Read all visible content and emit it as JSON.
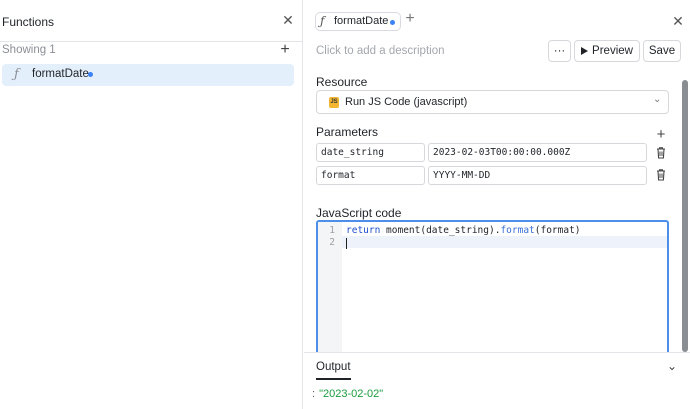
{
  "left_panel": {
    "title": "Functions",
    "close_glyph": "✕",
    "showing_label": "Showing 1",
    "add_glyph": "+",
    "functions": [
      {
        "icon": "function-icon",
        "glyph": "ƒ",
        "name": "formatDate",
        "unsaved": true
      }
    ]
  },
  "tab": {
    "glyph": "ƒ",
    "label": "formatDate",
    "add_glyph": "+",
    "close_glyph": "✕"
  },
  "toolbar": {
    "description_placeholder": "Click to add a description",
    "more_label": "···",
    "preview_label": "Preview",
    "save_label": "Save"
  },
  "resource": {
    "section_label": "Resource",
    "badge": "JS",
    "value": "Run JS Code (javascript)",
    "chevron": "⌄"
  },
  "parameters": {
    "section_label": "Parameters",
    "add_glyph": "+",
    "rows": [
      {
        "name": "date_string",
        "value": "2023-02-03T00:00:00.000Z"
      },
      {
        "name": "format",
        "value": "YYYY-MM-DD"
      }
    ]
  },
  "code": {
    "section_label": "JavaScript code",
    "line_numbers": [
      "1",
      "2"
    ],
    "line1": {
      "keyword": "return",
      "prefix": " moment(date_string).",
      "method": "format",
      "suffix": "(format)"
    },
    "line2": ""
  },
  "output": {
    "tab_label": "Output",
    "chevron": "⌄",
    "prefix": ":",
    "value": "\"2023-02-02\""
  },
  "colors": {
    "accent": "#4d8fe8",
    "selected_bg": "#e4effc",
    "unsaved_dot": "#3b82f6",
    "js_badge": "#f2b632",
    "output_green": "#1a9c3e"
  }
}
